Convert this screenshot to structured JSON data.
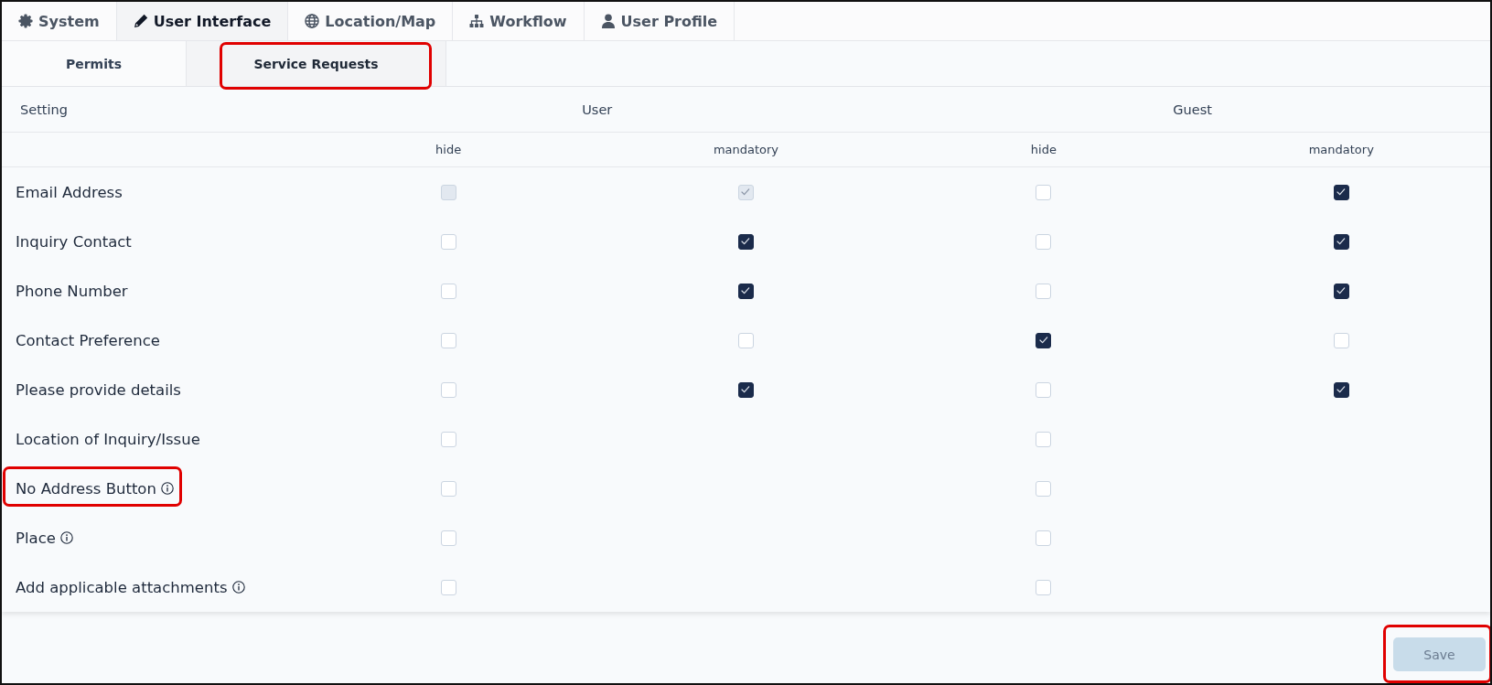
{
  "top_tabs": [
    {
      "label": "System",
      "selected": false
    },
    {
      "label": "User Interface",
      "selected": true
    },
    {
      "label": "Location/Map",
      "selected": false
    },
    {
      "label": "Workflow",
      "selected": false
    },
    {
      "label": "User Profile",
      "selected": false
    }
  ],
  "sub_tabs": [
    {
      "label": "Permits",
      "selected": false,
      "annotated": false
    },
    {
      "label": "Service Requests",
      "selected": true,
      "annotated": true
    }
  ],
  "table": {
    "setting_header": "Setting",
    "groups": [
      {
        "label": "User",
        "subcolumns": [
          "hide",
          "mandatory"
        ]
      },
      {
        "label": "Guest",
        "subcolumns": [
          "hide",
          "mandatory"
        ]
      }
    ],
    "rows": [
      {
        "label": "Email Address",
        "info": false,
        "annotated": false,
        "cells": [
          {
            "checked": false,
            "disabled": true
          },
          {
            "checked": true,
            "disabled": true
          },
          {
            "checked": false,
            "disabled": false
          },
          {
            "checked": true,
            "disabled": false
          }
        ]
      },
      {
        "label": "Inquiry Contact",
        "info": false,
        "annotated": false,
        "cells": [
          {
            "checked": false,
            "disabled": false
          },
          {
            "checked": true,
            "disabled": false
          },
          {
            "checked": false,
            "disabled": false
          },
          {
            "checked": true,
            "disabled": false
          }
        ]
      },
      {
        "label": "Phone Number",
        "info": false,
        "annotated": false,
        "cells": [
          {
            "checked": false,
            "disabled": false
          },
          {
            "checked": true,
            "disabled": false
          },
          {
            "checked": false,
            "disabled": false
          },
          {
            "checked": true,
            "disabled": false
          }
        ]
      },
      {
        "label": "Contact Preference",
        "info": false,
        "annotated": false,
        "cells": [
          {
            "checked": false,
            "disabled": false
          },
          {
            "checked": false,
            "disabled": false
          },
          {
            "checked": true,
            "disabled": false
          },
          {
            "checked": false,
            "disabled": false
          }
        ]
      },
      {
        "label": "Please provide details",
        "info": false,
        "annotated": false,
        "cells": [
          {
            "checked": false,
            "disabled": false
          },
          {
            "checked": true,
            "disabled": false
          },
          {
            "checked": false,
            "disabled": false
          },
          {
            "checked": true,
            "disabled": false
          }
        ]
      },
      {
        "label": "Location of Inquiry/Issue",
        "info": false,
        "annotated": false,
        "cells": [
          {
            "checked": false,
            "disabled": false
          },
          null,
          {
            "checked": false,
            "disabled": false
          },
          null
        ]
      },
      {
        "label": "No Address Button",
        "info": true,
        "annotated": true,
        "cells": [
          {
            "checked": false,
            "disabled": false
          },
          null,
          {
            "checked": false,
            "disabled": false
          },
          null
        ]
      },
      {
        "label": "Place",
        "info": true,
        "annotated": false,
        "cells": [
          {
            "checked": false,
            "disabled": false
          },
          null,
          {
            "checked": false,
            "disabled": false
          },
          null
        ]
      },
      {
        "label": "Add applicable attachments",
        "info": true,
        "annotated": false,
        "cells": [
          {
            "checked": false,
            "disabled": false
          },
          null,
          {
            "checked": false,
            "disabled": false
          },
          null
        ]
      }
    ]
  },
  "save_button": {
    "label": "Save",
    "disabled": true,
    "annotated": true
  }
}
